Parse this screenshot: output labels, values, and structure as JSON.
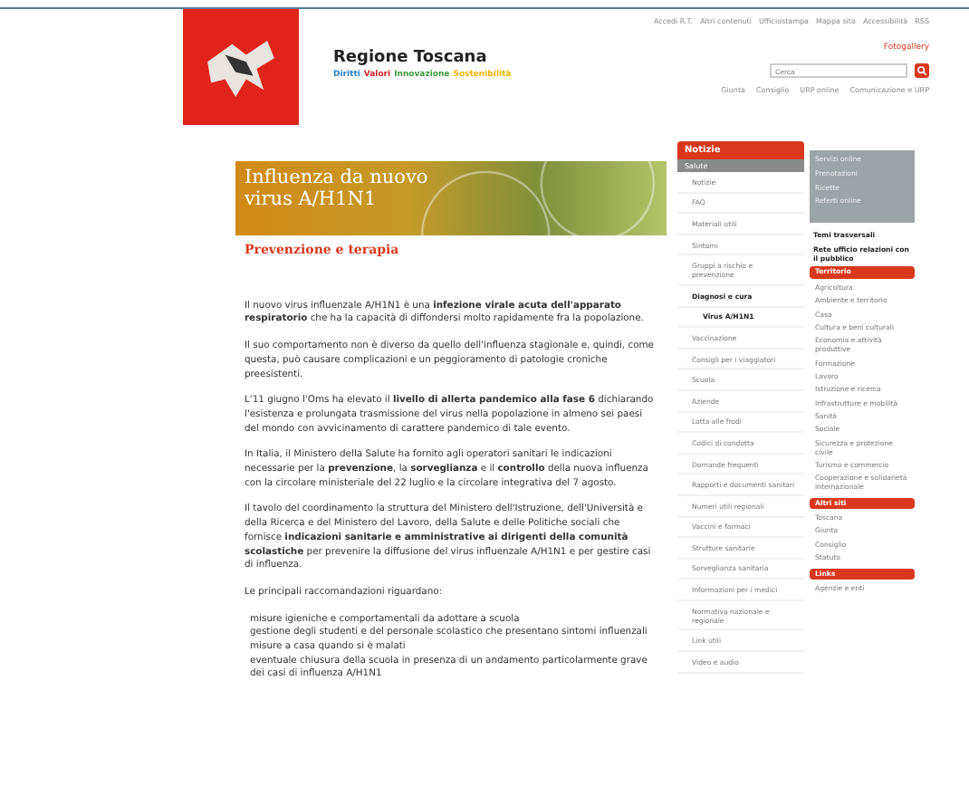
{
  "header": {
    "title": "Regione Toscana",
    "tagline": [
      {
        "text": "Diritti",
        "color": "#2a7fc9"
      },
      {
        "text": "Valori",
        "color": "#d2232a"
      },
      {
        "text": "Innovazione",
        "color": "#3b9a3b"
      },
      {
        "text": "Sostenibilità",
        "color": "#f0b400"
      }
    ],
    "top_links": [
      "Accedi R.T.",
      "Altri contenuti",
      "Ufficiostampa",
      "Mappa sito",
      "Accessibilità",
      "RSS"
    ],
    "gallery_link": "Fotogallery",
    "search": {
      "placeholder": "Cerca"
    },
    "nav_links": [
      "Giunta",
      "Consiglio",
      "URP online",
      "Comunicazione e URP"
    ]
  },
  "banner": {
    "title": "Influenza da nuovo virus A/H1N1"
  },
  "heading": "Prevenzione e terapia",
  "paragraphs": [
    "Il nuovo virus influenzale A/H1N1 è una **infezione virale acuta dell'apparato respiratorio** che ha la capacità di diffondersi molto rapidamente fra la popolazione.",
    "Il suo comportamento non è diverso da quello dell'influenza stagionale e, quindi, come questa, può causare complicazioni e un peggioramento di patologie croniche preesistenti.",
    "L'11 giugno l'Oms ha elevato il **livello di allerta pandemico alla fase 6** dichiarando l'esistenza e prolungata trasmissione del virus nella popolazione in almeno sei paesi del mondo con avvicinamento di carattere pandemico di tale evento.",
    "In Italia, il Ministero della Salute ha fornito agli operatori sanitari le indicazioni necessarie per la **prevenzione**, la **sorveglianza** e il **controllo** della nuova influenza con la circolare ministeriale del 22 luglio e la circolare integrativa del 7 agosto.",
    "Il tavolo del coordinamento la struttura del Ministero dell'Istruzione, dell'Università e della Ricerca e del Ministero del Lavoro, della Salute e delle Politiche sociali che fornisce **indicazioni sanitarie e amministrative ai dirigenti della comunità scolastiche** per prevenire la diffusione del virus influenzale A/H1N1 e per gestire casi di influenza.",
    "Le principali raccomandazioni riguardano:"
  ],
  "bullets": [
    "misure igieniche e comportamentali da adottare a scuola",
    "gestione degli studenti e del personale scolastico che presentano sintomi influenzali",
    "misure a casa quando si è malati",
    "eventuale chiusura della scuola in presenza di un andamento particolarmente grave dei casi di influenza A/H1N1"
  ],
  "sidebar": {
    "title": "Notizie",
    "subtitle": "Salute",
    "items": [
      {
        "label": "Notizie",
        "selected": false
      },
      {
        "label": "FAQ",
        "selected": false
      },
      {
        "label": "Materiali utili",
        "selected": false
      },
      {
        "label": "Sintomi",
        "selected": false
      },
      {
        "label": "Gruppi a rischio e prevenzione",
        "selected": false
      },
      {
        "label": "Diagnosi e cura",
        "selected": true,
        "children": [
          {
            "label": "Virus A/H1N1",
            "selected": true
          }
        ]
      },
      {
        "label": "Vaccinazione",
        "selected": false
      },
      {
        "label": "Consigli per i viaggiatori",
        "selected": false
      },
      {
        "label": "Scuola",
        "selected": false
      },
      {
        "label": "Aziende",
        "selected": false
      },
      {
        "label": "Lotta alle frodi",
        "selected": false
      },
      {
        "label": "Codici di condotta",
        "selected": false
      },
      {
        "label": "Domande frequenti",
        "selected": false
      },
      {
        "label": "Rapporti e documenti sanitari",
        "selected": false
      },
      {
        "label": "Numeri utili regionali",
        "selected": false
      },
      {
        "label": "Vaccini e farmaci",
        "selected": false
      },
      {
        "label": "Strutture sanitarie",
        "selected": false
      },
      {
        "label": "Sorveglianza sanitaria",
        "selected": false
      },
      {
        "label": "Informazioni per i medici",
        "selected": false
      },
      {
        "label": "Normativa nazionale e regionale",
        "selected": false
      },
      {
        "label": "Link utili",
        "selected": false
      },
      {
        "label": "Video e audio",
        "selected": false
      }
    ]
  },
  "right_column": {
    "box_lines": [
      "Servizi online",
      "Prenotazioni",
      "Ricette",
      "Referti online"
    ],
    "themes_title": "Temi trasversali",
    "featured": "Rete ufficio relazioni con il pubblico",
    "sections": [
      {
        "title": "Territorio",
        "links": [
          "Agricoltura",
          "Ambiente e territorio",
          "Casa",
          "Cultura e beni culturali",
          "Economia e attività produttive",
          "Formazione",
          "Lavoro",
          "Istruzione e ricerca",
          "Infrastrutture e mobilità",
          "Sanità",
          "Sociale",
          "Sicurezza e protezione civile",
          "Turismo e commercio",
          "Cooperazione e solidarietà internazionale"
        ]
      },
      {
        "title": "Altri siti",
        "links": [
          "Toscana",
          "Giunta",
          "Consiglio",
          "Statuto"
        ]
      },
      {
        "title": "Links",
        "links": [
          "Agenzie e enti"
        ]
      }
    ]
  }
}
